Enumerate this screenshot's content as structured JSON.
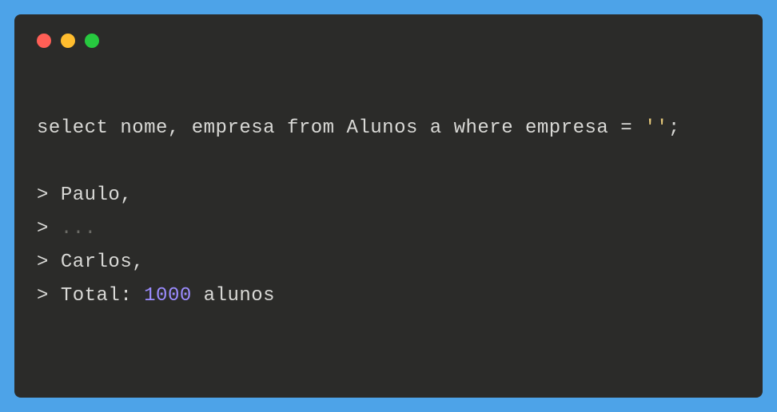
{
  "query": {
    "text_part1": "select nome, empresa from Alunos a where empresa = ",
    "string_literal": "''",
    "text_part2": ";"
  },
  "output": {
    "line1_prefix": "> ",
    "line1_value": "Paulo,",
    "line2_prefix": "> ",
    "line2_ellipsis": "...",
    "line3_prefix": "> ",
    "line3_value": "Carlos,",
    "line4_prefix": "> ",
    "line4_label": "Total: ",
    "line4_number": "1000",
    "line4_suffix": " alunos"
  }
}
